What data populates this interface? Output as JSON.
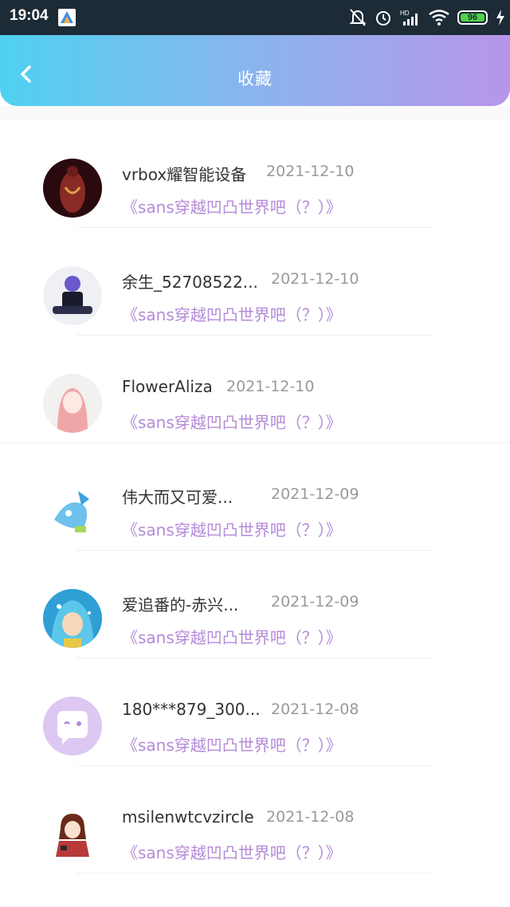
{
  "status_bar": {
    "time": "19:04",
    "battery_level": "96",
    "icons": [
      "app-icon",
      "mute-bell-icon",
      "alarm-icon",
      "hd-signal-icon",
      "wifi-icon",
      "battery-icon",
      "charging-icon"
    ]
  },
  "header": {
    "title": "收藏",
    "back_icon": "chevron-left-icon",
    "gradient_colors": [
      "#4fd1f0",
      "#b895ea"
    ]
  },
  "favorites": [
    {
      "name": "vrbox耀智能设备",
      "date": "2021-12-10",
      "work": "《sans穿越凹凸世界吧（？）》"
    },
    {
      "name": "余生_52708522...",
      "date": "2021-12-10",
      "work": "《sans穿越凹凸世界吧（？）》"
    },
    {
      "name": "FlowerAliza",
      "date": "2021-12-10",
      "work": "《sans穿越凹凸世界吧（？）》"
    },
    {
      "name": "伟大而又可爱...",
      "date": "2021-12-09",
      "work": "《sans穿越凹凸世界吧（？）》"
    },
    {
      "name": "爱追番的-赤兴...",
      "date": "2021-12-09",
      "work": "《sans穿越凹凸世界吧（？）》"
    },
    {
      "name": "180***879_300...",
      "date": "2021-12-08",
      "work": "《sans穿越凹凸世界吧（？）》"
    },
    {
      "name": "msilenwtcvzircle",
      "date": "2021-12-08",
      "work": "《sans穿越凹凸世界吧（？）》"
    }
  ],
  "colors": {
    "work_title": "#b48ad8",
    "date": "#999999",
    "name": "#333333"
  }
}
